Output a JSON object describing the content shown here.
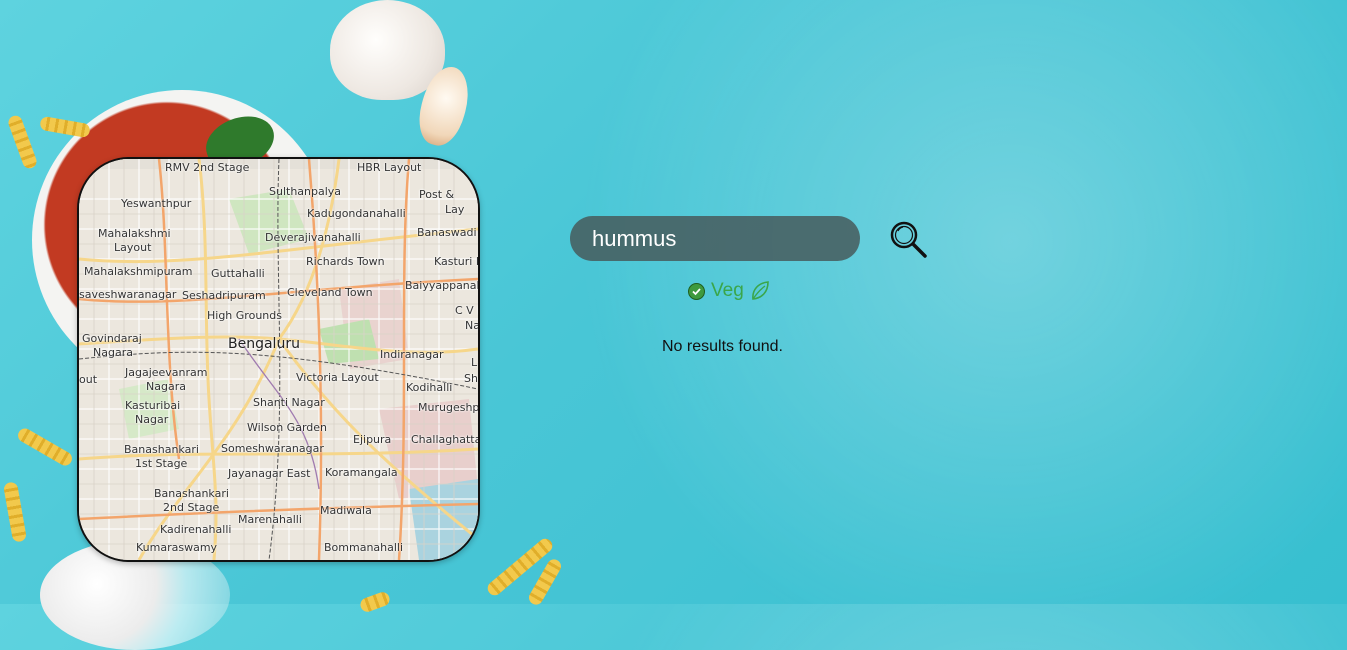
{
  "search": {
    "value": "hummus"
  },
  "filter": {
    "veg_label": "Veg",
    "veg_checked": true,
    "veg_color": "#3aa64a"
  },
  "results": {
    "empty_message": "No results found."
  },
  "map": {
    "city": "Bengaluru",
    "places": [
      "RMV 2nd Stage",
      "HBR Layout",
      "Sulthanpalya",
      "Post &",
      "Lay",
      "Yeswanthpur",
      "Kadugondanahalli",
      "Mahalakshmi",
      "Layout",
      "Deverajivanahalli",
      "Banaswadi",
      "Guttahalli",
      "Richards Town",
      "Kasturi N",
      "Mahalakshmipuram",
      "Baiyyappanah",
      "Seshadripuram",
      "Cleveland Town",
      "saveshwaranagar",
      "C V R",
      "Na",
      "High Grounds",
      "Govindaraj",
      "Nagara",
      "Indiranagar",
      "Jagajeevanram",
      "Nagara",
      "Victoria Layout",
      "out",
      "Kodihalli",
      "Kasturibai",
      "Nagar",
      "Shanti Nagar",
      "Murugeshp",
      "Wilson Garden",
      "Challaghatta",
      "Banashankari",
      "1st Stage",
      "Someshwaranagar",
      "Ejipura",
      "Jayanagar East",
      "Koramangala",
      "Banashankari",
      "2nd Stage",
      "Marenahalli",
      "Madiwala",
      "Kadirenahalli",
      "Kumaraswamy",
      "Bommanahalli",
      "L",
      "Sh"
    ]
  },
  "colors": {
    "background": "#49c6d6",
    "search_bg": "#465a5c",
    "map_border": "#111111"
  },
  "icons": {
    "search": "magnifier-icon",
    "veg": "leaf-icon",
    "check": "check-circle-icon"
  }
}
